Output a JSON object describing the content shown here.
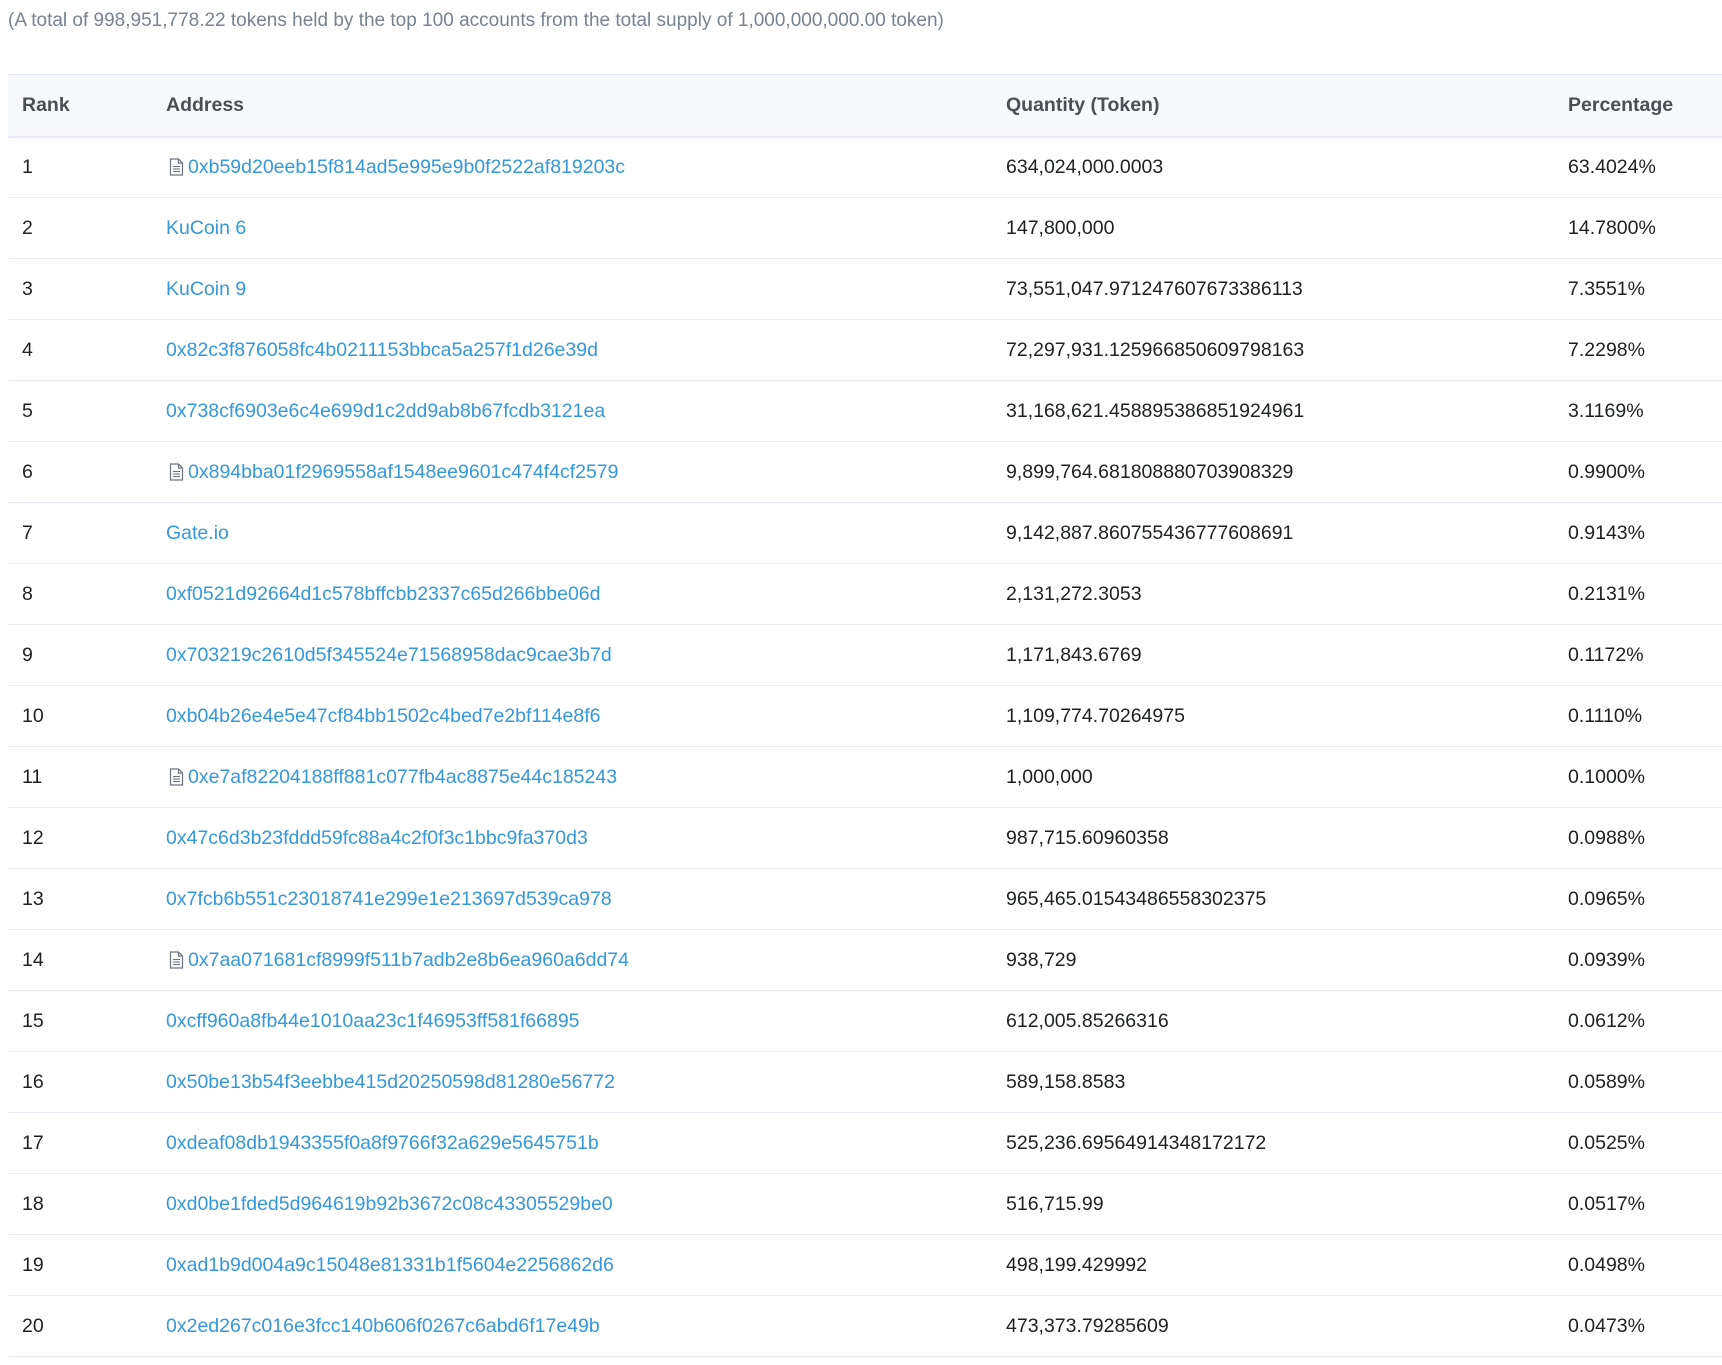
{
  "summary": "(A total of 998,951,778.22 tokens held by the top 100 accounts from the total supply of 1,000,000,000.00 token)",
  "colors": {
    "link": "#3498db",
    "muted": "#77838f",
    "border": "#e7eaf3"
  },
  "table": {
    "headers": {
      "rank": "Rank",
      "address": "Address",
      "quantity": "Quantity (Token)",
      "percentage": "Percentage"
    },
    "rows": [
      {
        "rank": "1",
        "address": "0xb59d20eeb15f814ad5e995e9b0f2522af819203c",
        "contract": true,
        "quantity": "634,024,000.0003",
        "percentage": "63.4024%"
      },
      {
        "rank": "2",
        "address": "KuCoin 6",
        "contract": false,
        "quantity": "147,800,000",
        "percentage": "14.7800%"
      },
      {
        "rank": "3",
        "address": "KuCoin 9",
        "contract": false,
        "quantity": "73,551,047.971247607673386113",
        "percentage": "7.3551%"
      },
      {
        "rank": "4",
        "address": "0x82c3f876058fc4b0211153bbca5a257f1d26e39d",
        "contract": false,
        "quantity": "72,297,931.125966850609798163",
        "percentage": "7.2298%"
      },
      {
        "rank": "5",
        "address": "0x738cf6903e6c4e699d1c2dd9ab8b67fcdb3121ea",
        "contract": false,
        "quantity": "31,168,621.458895386851924961",
        "percentage": "3.1169%"
      },
      {
        "rank": "6",
        "address": "0x894bba01f2969558af1548ee9601c474f4cf2579",
        "contract": true,
        "quantity": "9,899,764.681808880703908329",
        "percentage": "0.9900%"
      },
      {
        "rank": "7",
        "address": "Gate.io",
        "contract": false,
        "quantity": "9,142,887.860755436777608691",
        "percentage": "0.9143%"
      },
      {
        "rank": "8",
        "address": "0xf0521d92664d1c578bffcbb2337c65d266bbe06d",
        "contract": false,
        "quantity": "2,131,272.3053",
        "percentage": "0.2131%"
      },
      {
        "rank": "9",
        "address": "0x703219c2610d5f345524e71568958dac9cae3b7d",
        "contract": false,
        "quantity": "1,171,843.6769",
        "percentage": "0.1172%"
      },
      {
        "rank": "10",
        "address": "0xb04b26e4e5e47cf84bb1502c4bed7e2bf114e8f6",
        "contract": false,
        "quantity": "1,109,774.70264975",
        "percentage": "0.1110%"
      },
      {
        "rank": "11",
        "address": "0xe7af82204188ff881c077fb4ac8875e44c185243",
        "contract": true,
        "quantity": "1,000,000",
        "percentage": "0.1000%"
      },
      {
        "rank": "12",
        "address": "0x47c6d3b23fddd59fc88a4c2f0f3c1bbc9fa370d3",
        "contract": false,
        "quantity": "987,715.60960358",
        "percentage": "0.0988%"
      },
      {
        "rank": "13",
        "address": "0x7fcb6b551c23018741e299e1e213697d539ca978",
        "contract": false,
        "quantity": "965,465.01543486558302375",
        "percentage": "0.0965%"
      },
      {
        "rank": "14",
        "address": "0x7aa071681cf8999f511b7adb2e8b6ea960a6dd74",
        "contract": true,
        "quantity": "938,729",
        "percentage": "0.0939%"
      },
      {
        "rank": "15",
        "address": "0xcff960a8fb44e1010aa23c1f46953ff581f66895",
        "contract": false,
        "quantity": "612,005.85266316",
        "percentage": "0.0612%"
      },
      {
        "rank": "16",
        "address": "0x50be13b54f3eebbe415d20250598d81280e56772",
        "contract": false,
        "quantity": "589,158.8583",
        "percentage": "0.0589%"
      },
      {
        "rank": "17",
        "address": "0xdeaf08db1943355f0a8f9766f32a629e5645751b",
        "contract": false,
        "quantity": "525,236.69564914348172172",
        "percentage": "0.0525%"
      },
      {
        "rank": "18",
        "address": "0xd0be1fded5d964619b92b3672c08c43305529be0",
        "contract": false,
        "quantity": "516,715.99",
        "percentage": "0.0517%"
      },
      {
        "rank": "19",
        "address": "0xad1b9d004a9c15048e81331b1f5604e2256862d6",
        "contract": false,
        "quantity": "498,199.429992",
        "percentage": "0.0498%"
      },
      {
        "rank": "20",
        "address": "0x2ed267c016e3fcc140b606f0267c6abd6f17e49b",
        "contract": false,
        "quantity": "473,373.79285609",
        "percentage": "0.0473%"
      }
    ]
  }
}
